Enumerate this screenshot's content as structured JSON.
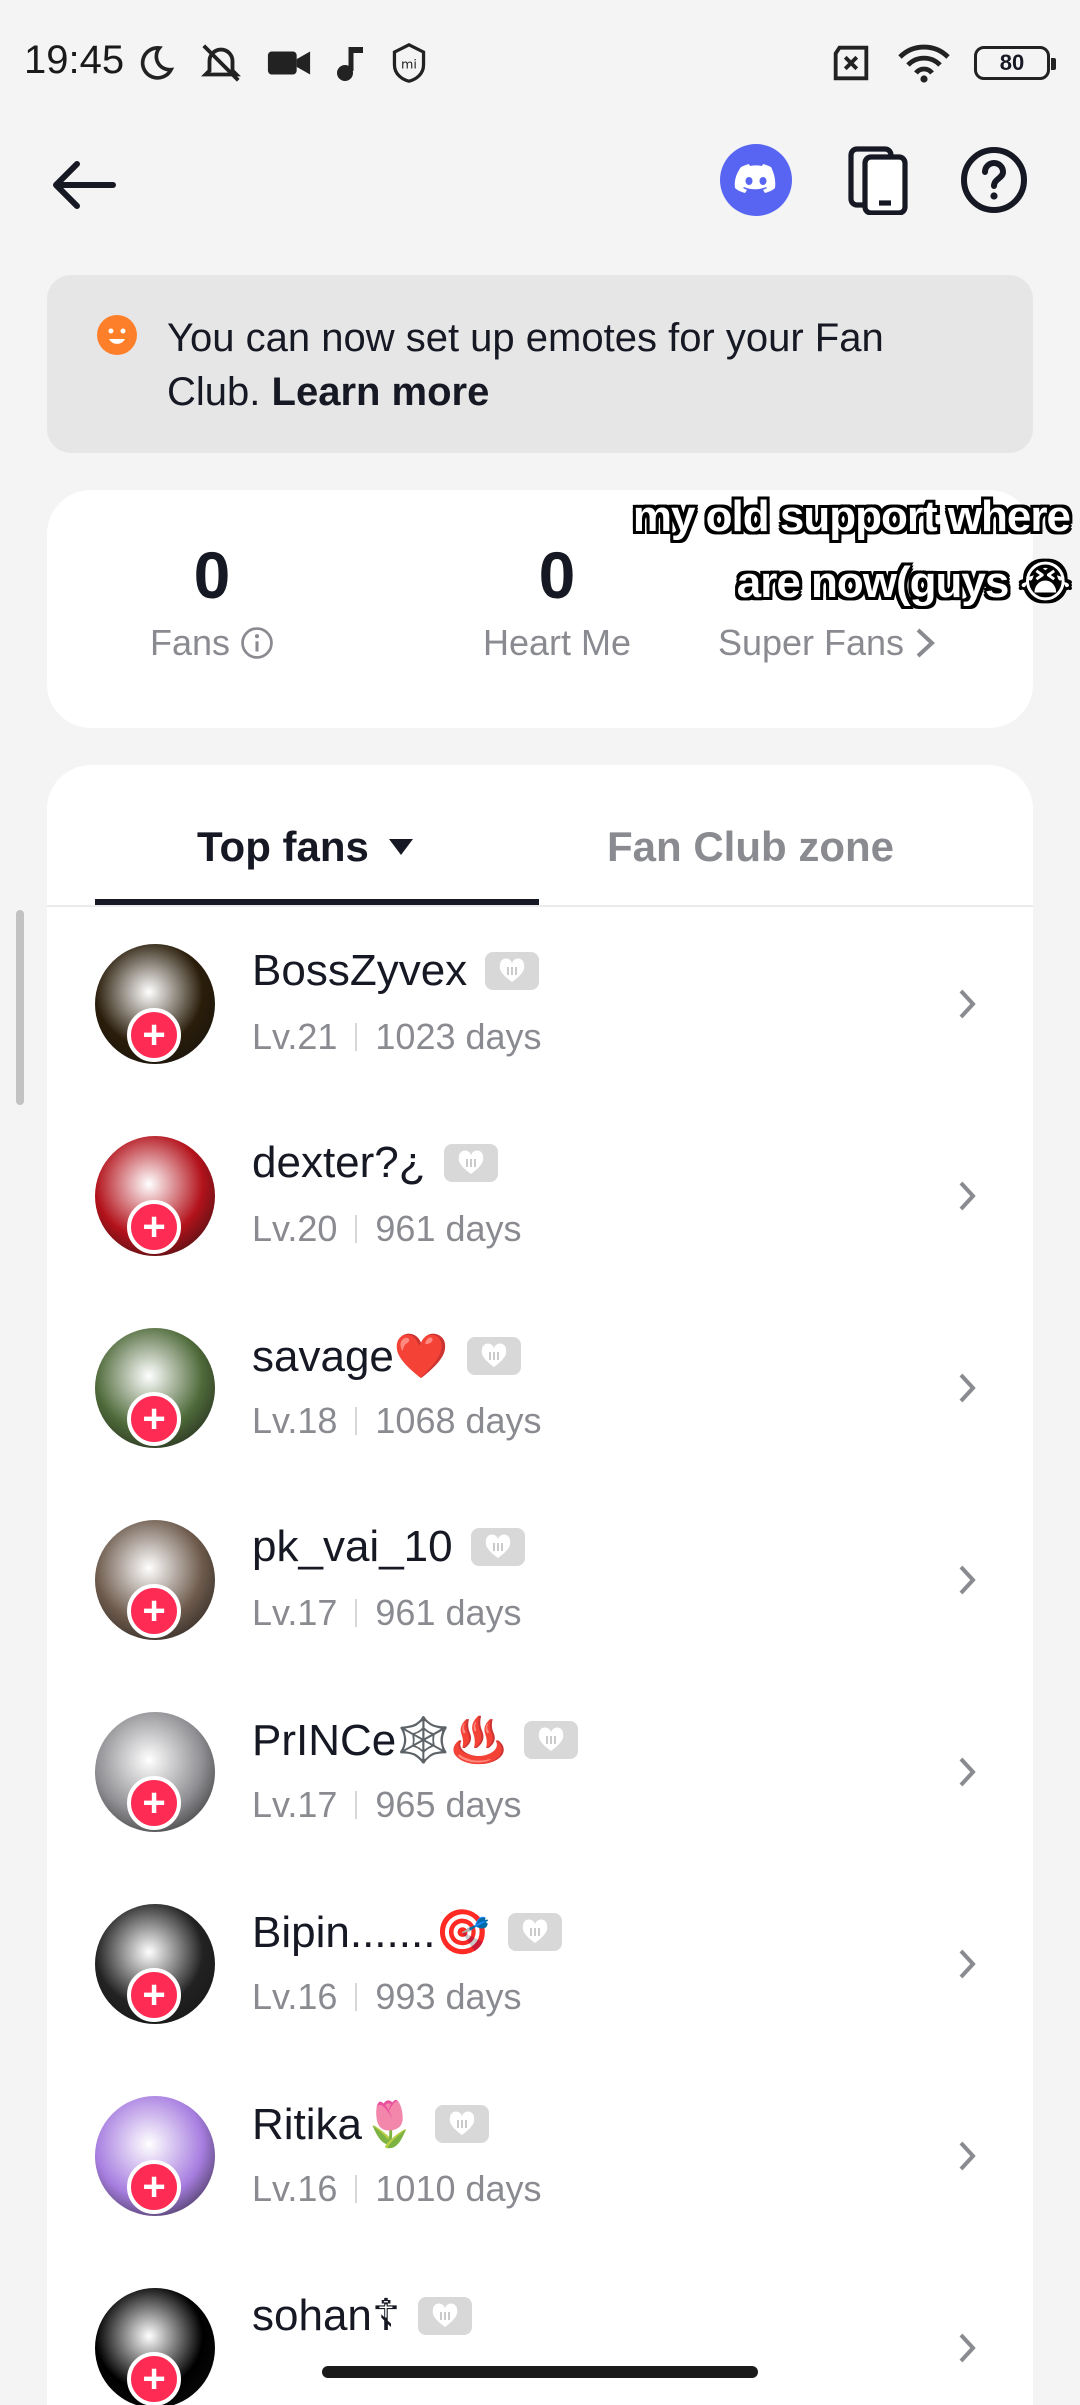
{
  "status": {
    "time": "19:45",
    "battery": "80"
  },
  "banner": {
    "text": "You can now set up emotes for your Fan Club.",
    "link": "Learn more"
  },
  "stats": {
    "fans_value": "0",
    "fans_label": "Fans",
    "heart_value": "0",
    "heart_label": "Heart Me",
    "super_label": "Super Fans"
  },
  "overlay": {
    "line1": "my old support where",
    "line2": "are now(guys 😭"
  },
  "tabs": {
    "top_fans": "Top fans",
    "fan_club_zone": "Fan Club zone"
  },
  "fans": [
    {
      "name": "BossZyvex",
      "level": "Lv.21",
      "days": "1023 days",
      "avatar_color": "#2a1d0a"
    },
    {
      "name": "dexter?¿",
      "level": "Lv.20",
      "days": "961 days",
      "avatar_color": "#b3121b"
    },
    {
      "name": "savage❤️",
      "level": "Lv.18",
      "days": "1068 days",
      "avatar_color": "#4f6a3a"
    },
    {
      "name": "pk_vai_10",
      "level": "Lv.17",
      "days": "961 days",
      "avatar_color": "#6d5a4c"
    },
    {
      "name": "PrINCe🕸️♨️",
      "level": "Lv.17",
      "days": "965 days",
      "avatar_color": "#8f8f93"
    },
    {
      "name": "Bipin.......🎯",
      "level": "Lv.16",
      "days": "993 days",
      "avatar_color": "#222222"
    },
    {
      "name": "Ritika🌷",
      "level": "Lv.16",
      "days": "1010 days",
      "avatar_color": "#a77ee0"
    },
    {
      "name": "sohan☦",
      "level": "",
      "days": "",
      "avatar_color": "#000000"
    }
  ],
  "colors": {
    "accent": "#fe2c55",
    "discord": "#5865f2",
    "banner_icon": "#fe7f29"
  }
}
